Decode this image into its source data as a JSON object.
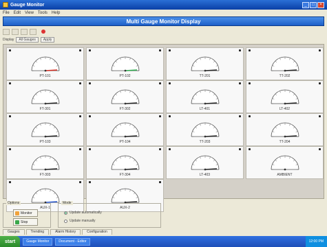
{
  "window": {
    "title": "Gauge Monitor"
  },
  "menu": [
    "File",
    "Edit",
    "View",
    "Tools",
    "Help"
  ],
  "banner": {
    "title": "Multi Gauge Monitor Display"
  },
  "optbar": {
    "label": "Display",
    "value": "All Gauges",
    "button": "Apply"
  },
  "gauges": [
    {
      "label": "PT-101",
      "needle": "red"
    },
    {
      "label": "PT-102",
      "needle": "green"
    },
    {
      "label": "TT-201",
      "needle": "dark"
    },
    {
      "label": "TT-202",
      "needle": "dark"
    },
    {
      "label": "FT-301",
      "needle": "dark"
    },
    {
      "label": "FT-302",
      "needle": "dark"
    },
    {
      "label": "LT-401",
      "needle": "dark"
    },
    {
      "label": "LT-402",
      "needle": "dark"
    },
    {
      "label": "PT-103",
      "needle": "dark"
    },
    {
      "label": "PT-104",
      "needle": "dark"
    },
    {
      "label": "TT-203",
      "needle": "dark"
    },
    {
      "label": "TT-204",
      "needle": "dark"
    },
    {
      "label": "FT-303",
      "needle": "dark"
    },
    {
      "label": "FT-304",
      "needle": "dark"
    },
    {
      "label": "LT-403",
      "needle": "dark"
    },
    {
      "label": "AMBIENT",
      "needle": "none"
    },
    {
      "label": "AUX-1",
      "needle": "blue"
    },
    {
      "label": "AUX-2",
      "needle": "dark"
    }
  ],
  "options": {
    "group1_title": "Options",
    "btn_monitor": "Monitor",
    "btn_stop": "Stop",
    "group2_title": "Mode",
    "radio1": "Update automatically",
    "radio2": "Update manually"
  },
  "tabs": [
    "Gauges",
    "Trending",
    "Alarm History",
    "Configuration"
  ],
  "taskbar": {
    "start": "start",
    "tasks": [
      "Gauge Monitor",
      "Document - Editor"
    ],
    "clock": "12:00 PM"
  },
  "colors": {
    "needle_red": "#d22a1e",
    "needle_green": "#2aa84a",
    "needle_dark": "#222222",
    "needle_blue": "#1f4fc8"
  }
}
